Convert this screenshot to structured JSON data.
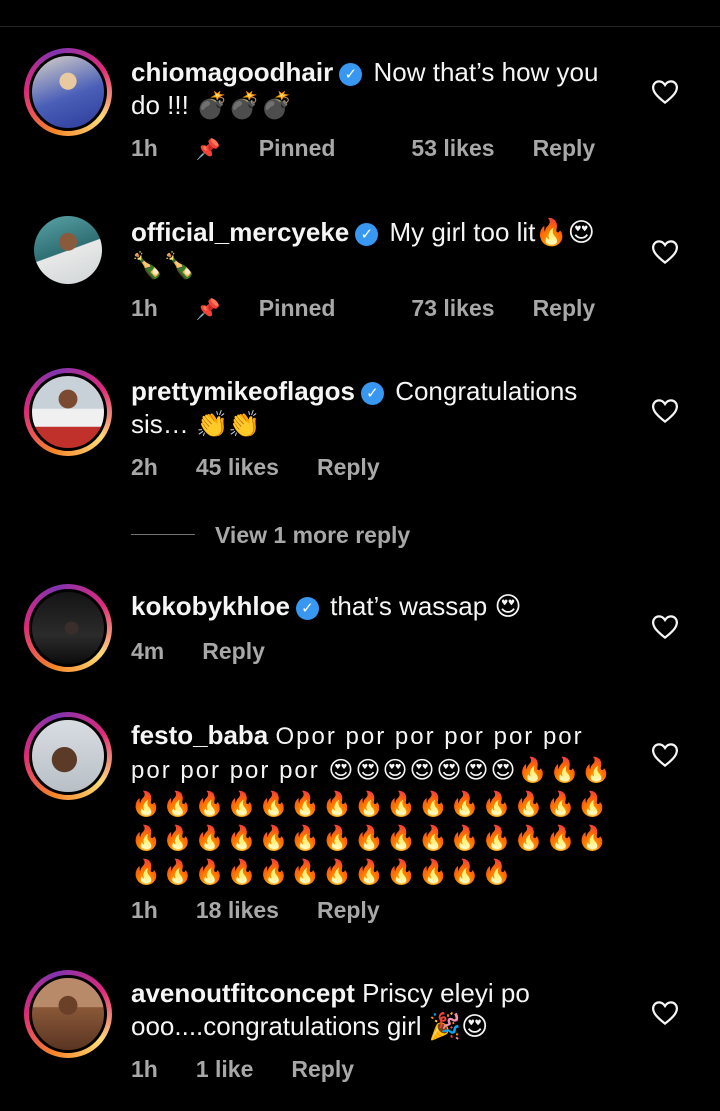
{
  "comments": [
    {
      "username": "chiomagoodhair",
      "verified": true,
      "text": "Now that’s how you do !!! 💣💣💣",
      "time": "1h",
      "pinned": "Pinned",
      "likes": "53 likes",
      "reply": "Reply"
    },
    {
      "username": "official_mercyeke",
      "verified": true,
      "text": "My girl too lit🔥😍 🍾🍾",
      "time": "1h",
      "pinned": "Pinned",
      "likes": "73 likes",
      "reply": "Reply"
    },
    {
      "username": "prettymikeoflagos",
      "verified": true,
      "text": "Congratulations sis… 👏👏",
      "time": "2h",
      "likes": "45 likes",
      "reply": "Reply",
      "view_more": "View 1 more reply"
    },
    {
      "username": "kokobykhloe",
      "verified": true,
      "text": "that’s wassap 😍",
      "time": "4m",
      "reply": "Reply"
    },
    {
      "username": "festo_baba",
      "verified": false,
      "text": "Opor por por por por por por por por por 😍😍😍😍😍😍😍🔥🔥🔥🔥🔥🔥🔥🔥🔥🔥🔥🔥🔥🔥🔥🔥🔥🔥🔥🔥🔥🔥🔥🔥🔥🔥🔥🔥🔥🔥🔥🔥🔥🔥🔥🔥🔥🔥🔥🔥🔥🔥🔥🔥🔥",
      "time": "1h",
      "likes": "18 likes",
      "reply": "Reply"
    },
    {
      "username": "avenoutfitconcept",
      "verified": false,
      "text": "Priscy eleyi po ooo....congratulations girl 🎉😍",
      "time": "1h",
      "likes": "1 like",
      "reply": "Reply"
    }
  ],
  "icons": {
    "heart": "heart-icon",
    "pin": "pin-icon",
    "verified": "verified-badge-icon"
  },
  "colors": {
    "background": "#000000",
    "text": "#f5f5f5",
    "meta": "#a8a8a8",
    "verified": "#3897f0"
  }
}
